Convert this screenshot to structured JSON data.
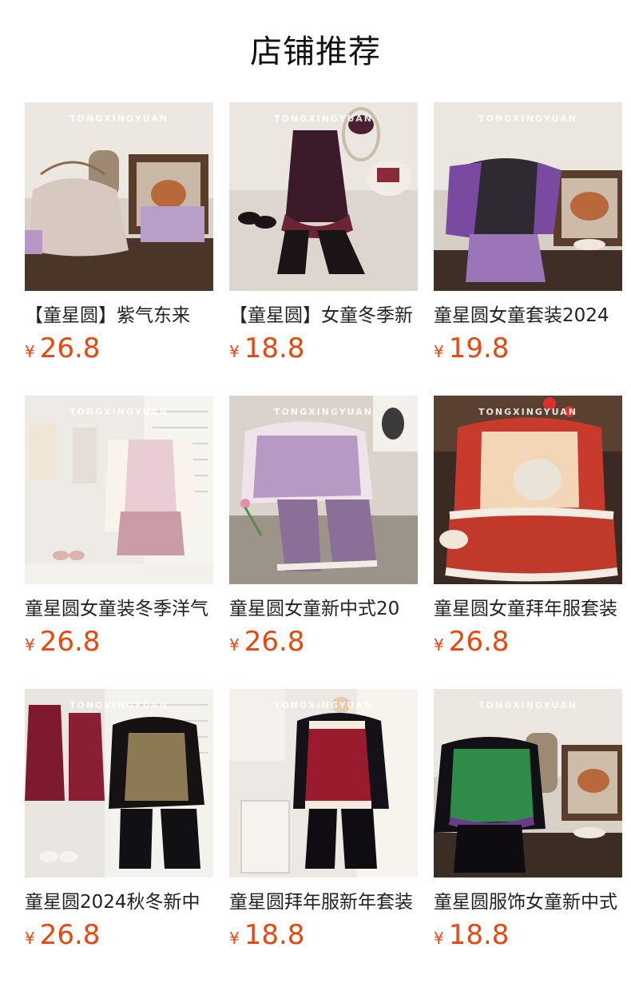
{
  "header": {
    "title": "店铺推荐"
  },
  "colors": {
    "price": "#e8470e",
    "title": "#111111",
    "name": "#222222"
  },
  "products": [
    {
      "name": "【童星圆】紫气东来",
      "currency": "¥",
      "price": "26.8",
      "watermark": "TONGXINGYUAN",
      "image": "lavender-floral-jacket-set"
    },
    {
      "name": "【童星圆】女童冬季新",
      "currency": "¥",
      "price": "18.8",
      "watermark": "TONGXINGYUAN",
      "image": "purple-sequin-fur-vest-set"
    },
    {
      "name": "童星圆女童套装2024",
      "currency": "¥",
      "price": "19.8",
      "watermark": "TONGXINGYUAN",
      "image": "purple-crane-fur-jacket-set"
    },
    {
      "name": "童星圆女童装冬季洋气",
      "currency": "¥",
      "price": "26.8",
      "watermark": "TONGXINGYUAN",
      "image": "pink-vest-white-top-set"
    },
    {
      "name": "童星圆女童新中式20",
      "currency": "¥",
      "price": "26.8",
      "watermark": "TONGXINGYUAN",
      "image": "lilac-floral-corduroy-set"
    },
    {
      "name": "童星圆女童拜年服套装",
      "currency": "¥",
      "price": "26.8",
      "watermark": "TONGXINGYUAN",
      "image": "red-new-year-fur-set"
    },
    {
      "name": "童星圆2024秋冬新中",
      "currency": "¥",
      "price": "26.8",
      "watermark": "TONGXINGYUAN",
      "image": "gold-butterfly-fur-vest-set"
    },
    {
      "name": "童星圆拜年服新年套装",
      "currency": "¥",
      "price": "18.8",
      "watermark": "TONGXINGYUAN",
      "image": "red-velvet-fur-vest-set"
    },
    {
      "name": "童星圆服饰女童新中式",
      "currency": "¥",
      "price": "18.8",
      "watermark": "TONGXINGYUAN",
      "image": "green-butterfly-vest-set"
    }
  ]
}
